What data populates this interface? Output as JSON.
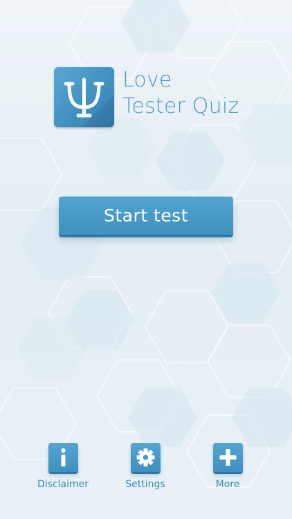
{
  "app": {
    "title_line1": "Love",
    "title_line2": "Tester Quiz",
    "logo_glyph": "psi-icon"
  },
  "main": {
    "start_button_label": "Start test"
  },
  "bottom_nav": {
    "items": [
      {
        "label": "Disclaimer",
        "icon": "info-icon"
      },
      {
        "label": "Settings",
        "icon": "gear-icon"
      },
      {
        "label": "More",
        "icon": "plus-icon"
      }
    ]
  },
  "colors": {
    "accent": "#4a97c4",
    "button": "#4191c1",
    "button_shadow": "#2f78a6",
    "background": "#e8f0f5"
  }
}
